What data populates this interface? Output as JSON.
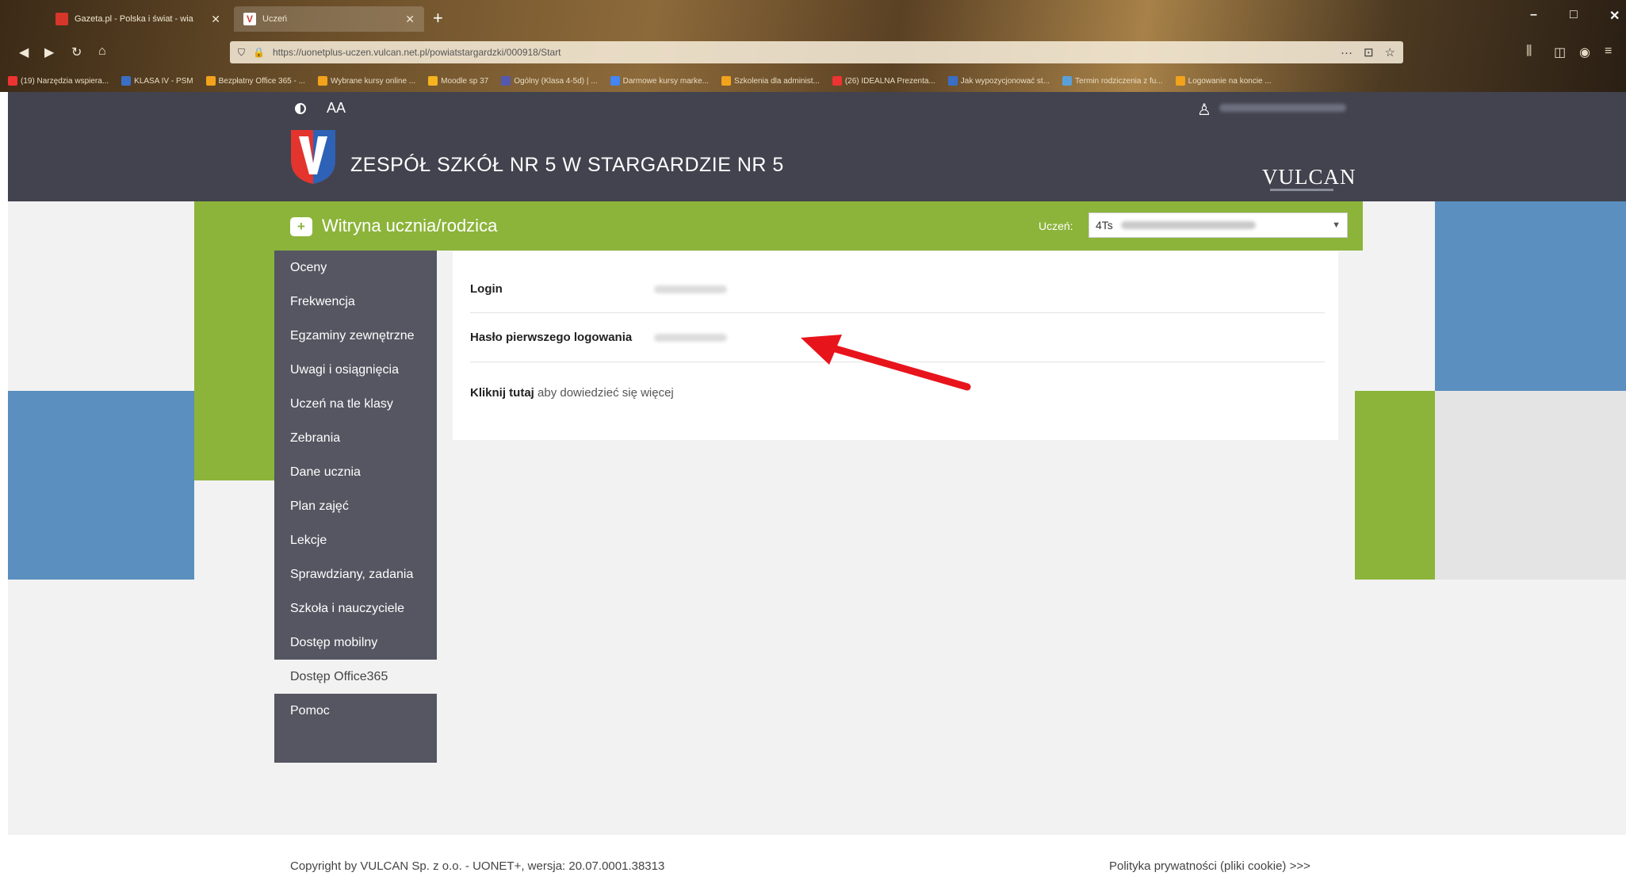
{
  "browser": {
    "tabs": [
      {
        "label": "Gazeta.pl - Polska i świat - wia",
        "favicon_color": "#d7362b",
        "active": false
      },
      {
        "label": "Uczeń",
        "favicon_color": "#d63a2e",
        "active": true
      }
    ],
    "new_tab_label": "+",
    "url": "https://uonetplus-uczen.vulcan.net.pl/powiatstargardzki/000918/Start",
    "url_actions": [
      "···",
      "⊡",
      "☆"
    ],
    "bookmarks": [
      {
        "label": "(19) Narzędzia wspiera...",
        "color": "#e33"
      },
      {
        "label": "KLASA IV - PSM",
        "color": "#3b6fc7"
      },
      {
        "label": "Bezpłatny Office 365 - ...",
        "color": "#f2a31b"
      },
      {
        "label": "Wybrane kursy online ...",
        "color": "#f2a31b"
      },
      {
        "label": "Moodle sp 37",
        "color": "#f5b31e"
      },
      {
        "label": "Ogólny (Klasa 4-5d) | ...",
        "color": "#5558af"
      },
      {
        "label": "Darmowe kursy marke...",
        "color": "#4285f4"
      },
      {
        "label": "Szkolenia dla administ...",
        "color": "#f2a31b"
      },
      {
        "label": "(26) IDEALNA Prezenta...",
        "color": "#e33"
      },
      {
        "label": "Jak wypozycjonować st...",
        "color": "#3b6fc7"
      },
      {
        "label": "Termin rodziczenia z fu...",
        "color": "#5aa0d8"
      },
      {
        "label": "Logowanie na koncie ...",
        "color": "#f2a31b"
      }
    ]
  },
  "header": {
    "font_size_label": "AA",
    "school_name": "ZESPÓŁ SZKÓŁ NR 5 W STARGARDZIE NR 5",
    "brand": "VULCAN"
  },
  "greenbar": {
    "icon": "+",
    "title": "Witryna ucznia/rodzica",
    "student_label": "Uczeń:",
    "student_value": "4Ts"
  },
  "sidebar": {
    "items": [
      {
        "label": "Oceny"
      },
      {
        "label": "Frekwencja"
      },
      {
        "label": "Egzaminy zewnętrzne"
      },
      {
        "label": "Uwagi i osiągnięcia"
      },
      {
        "label": "Uczeń na tle klasy"
      },
      {
        "label": "Zebrania"
      },
      {
        "label": "Dane ucznia"
      },
      {
        "label": "Plan zajęć"
      },
      {
        "label": "Lekcje"
      },
      {
        "label": "Sprawdziany, zadania"
      },
      {
        "label": "Szkoła i nauczyciele"
      },
      {
        "label": "Dostęp mobilny"
      },
      {
        "label": "Dostęp Office365"
      },
      {
        "label": "Pomoc"
      }
    ]
  },
  "content": {
    "login_label": "Login",
    "password_label": "Hasło pierwszego logowania",
    "more_link": "Kliknij tutaj",
    "more_text": " aby dowiedzieć się więcej"
  },
  "footer": {
    "copyright": "Copyright by VULCAN Sp. z o.o. - UONET+, wersja: 20.07.0001.38313",
    "privacy": "Polityka prywatności (pliki cookie) >>>"
  },
  "colors": {
    "header_bg": "#42434e",
    "green": "#8cb43a",
    "blue": "#5a8fbf",
    "sidebar_bg": "#555661",
    "arrow": "#e8141c"
  }
}
